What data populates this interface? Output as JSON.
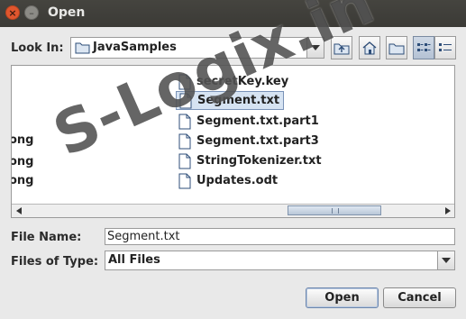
{
  "window": {
    "title": "Open"
  },
  "look_in": {
    "label": "Look In:",
    "value": "JavaSamples"
  },
  "toolbar": {
    "buttons": [
      "up-one-level",
      "home",
      "new-folder",
      "list-view",
      "details-view"
    ],
    "active": "list-view"
  },
  "files": {
    "left_column_partial": [
      "ong",
      "ong",
      "ong"
    ],
    "items": [
      {
        "name": "secretKey.key",
        "selected": false
      },
      {
        "name": "Segment.txt",
        "selected": true
      },
      {
        "name": "Segment.txt.part1",
        "selected": false
      },
      {
        "name": "Segment.txt.part3",
        "selected": false
      },
      {
        "name": "StringTokenizer.txt",
        "selected": false
      },
      {
        "name": "Updates.odt",
        "selected": false
      }
    ]
  },
  "file_name": {
    "label": "File Name:",
    "value": "Segment.txt"
  },
  "files_of_type": {
    "label": "Files of Type:",
    "value": "All Files"
  },
  "buttons": {
    "open": "Open",
    "cancel": "Cancel"
  },
  "watermark": "S-Logix.in"
}
